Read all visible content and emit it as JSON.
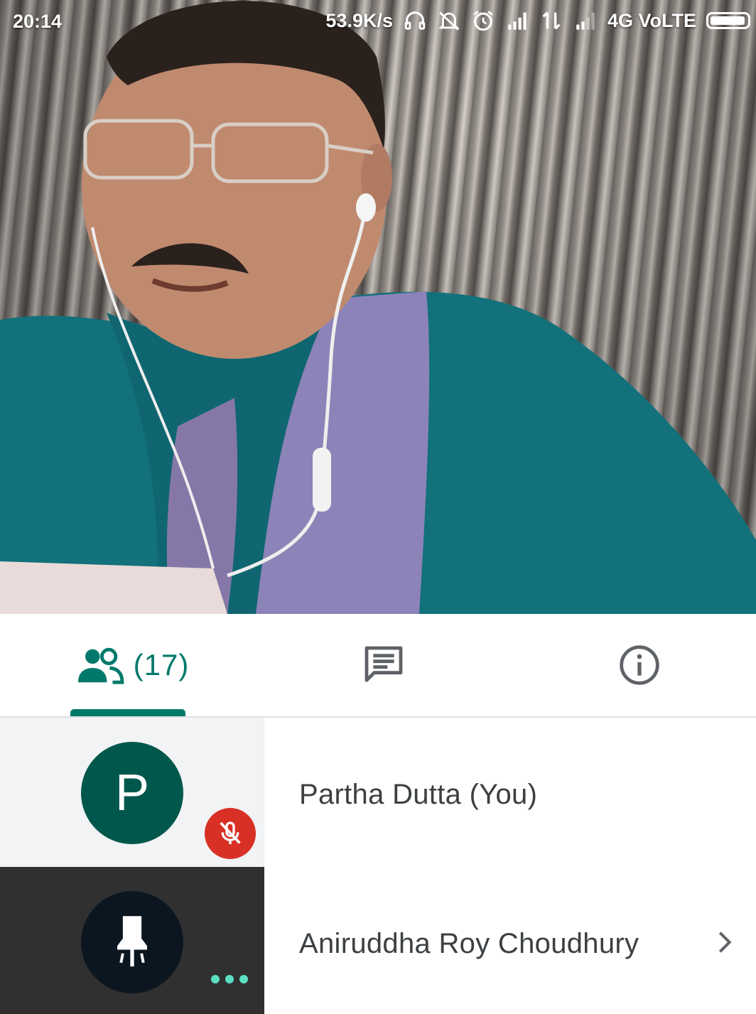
{
  "status_bar": {
    "time": "20:14",
    "network_speed": "53.9K/s",
    "network_type": "4G VoLTE",
    "icons": [
      "headset-icon",
      "bell-off-icon",
      "alarm-icon",
      "signal-icon",
      "data-arrows-icon",
      "signal-weak-icon",
      "battery-icon"
    ]
  },
  "video": {
    "description_icon": "camera-feed"
  },
  "tabs": {
    "people_count": "(17)",
    "people_icon": "people-icon",
    "chat_icon": "chat-icon",
    "info_icon": "info-icon",
    "active": "people"
  },
  "participants": [
    {
      "initial": "P",
      "name": "Partha Dutta (You)",
      "avatar_color": "#00574b",
      "status_icon": "mic-off-icon"
    },
    {
      "name": "Aniruddha Roy Choudhury",
      "avatar_icon": "pin-icon",
      "status_icon": "more-dots-icon",
      "action_icon": "chevron-right-icon"
    }
  ],
  "colors": {
    "accent": "#00796b",
    "mute_red": "#d93025",
    "text": "#3c4043"
  }
}
